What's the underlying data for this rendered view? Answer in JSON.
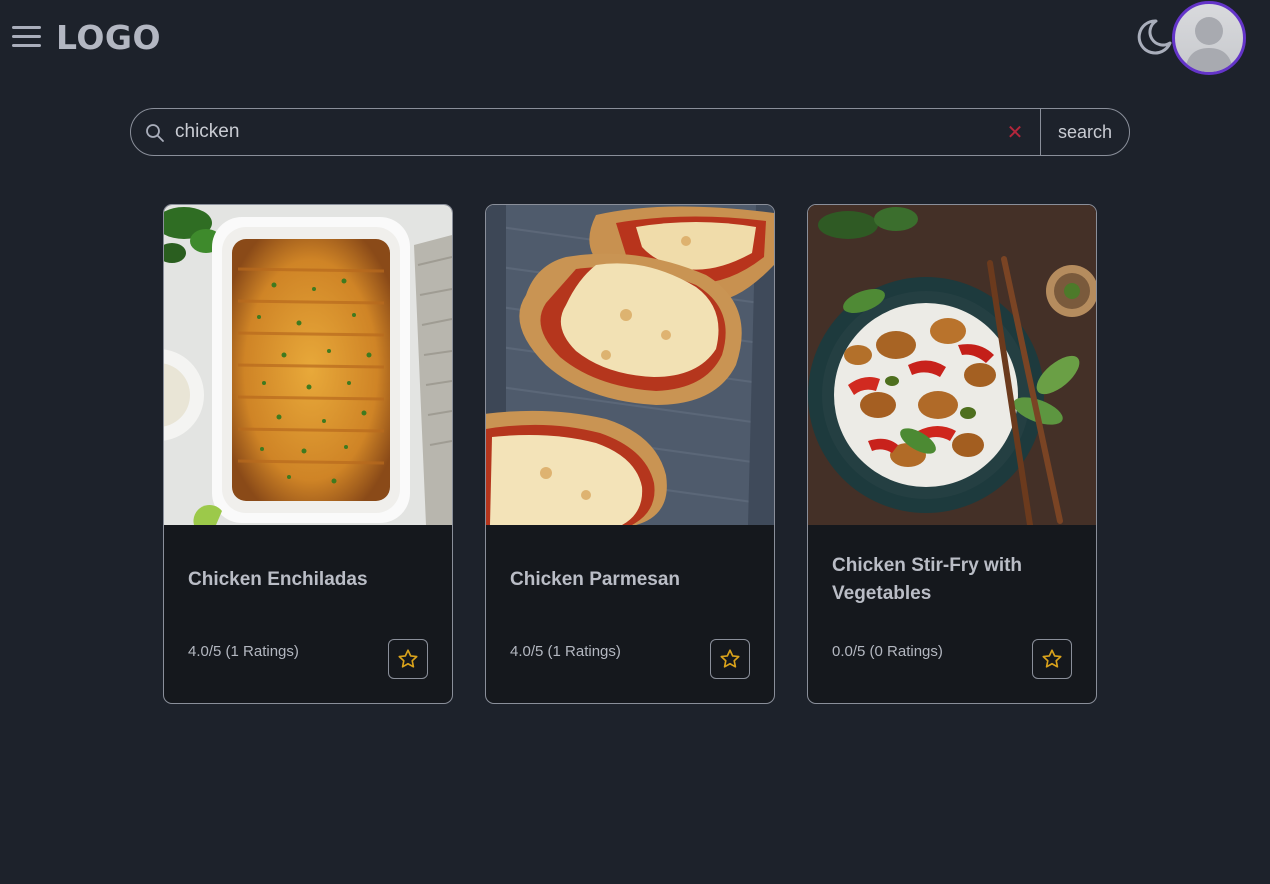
{
  "header": {
    "logo_text": "LOGO",
    "menu_icon": "hamburger-menu-icon",
    "theme_icon": "moon-icon",
    "avatar_icon": "user-avatar-icon",
    "accent_color": "#6434c9"
  },
  "search": {
    "value": "chicken",
    "placeholder": "",
    "button_label": "search",
    "clear_icon": "close-icon",
    "clear_color": "#b3263b"
  },
  "results": [
    {
      "title": "Chicken Enchiladas",
      "rating": "4.0/5 (1 Ratings)",
      "image": "enchiladas-casserole-photo",
      "favorite_icon": "star-outline-icon"
    },
    {
      "title": "Chicken Parmesan",
      "rating": "4.0/5 (1 Ratings)",
      "image": "chicken-parmesan-photo",
      "favorite_icon": "star-outline-icon"
    },
    {
      "title": "Chicken Stir-Fry with Vegetables",
      "rating": "0.0/5 (0 Ratings)",
      "image": "stir-fry-bowl-photo",
      "favorite_icon": "star-outline-icon"
    }
  ],
  "colors": {
    "background": "#1d222b",
    "card_background": "#15181d",
    "star": "#d9a21b"
  }
}
